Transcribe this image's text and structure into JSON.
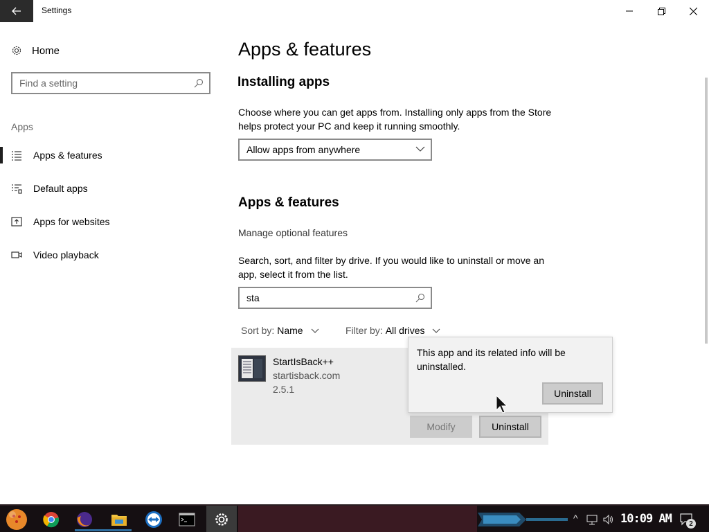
{
  "window": {
    "title": "Settings",
    "controls": [
      "minimize",
      "maximize",
      "close"
    ]
  },
  "sidebar": {
    "home_label": "Home",
    "search_placeholder": "Find a setting",
    "group_label": "Apps",
    "items": [
      {
        "label": "Apps & features",
        "icon": "apps-list-icon",
        "active": true
      },
      {
        "label": "Default apps",
        "icon": "default-apps-icon",
        "active": false
      },
      {
        "label": "Apps for websites",
        "icon": "apps-websites-icon",
        "active": false
      },
      {
        "label": "Video playback",
        "icon": "video-icon",
        "active": false
      }
    ]
  },
  "main": {
    "page_title": "Apps & features",
    "installing": {
      "heading": "Installing apps",
      "description": "Choose where you can get apps from. Installing only apps from the Store helps protect your PC and keep it running smoothly.",
      "dropdown_value": "Allow apps from anywhere"
    },
    "features": {
      "heading": "Apps & features",
      "manage_link": "Manage optional features",
      "description": "Search, sort, and filter by drive. If you would like to uninstall or move an app, select it from the list.",
      "search_value": "sta",
      "sort_label": "Sort by:",
      "sort_value": "Name",
      "filter_label": "Filter by:",
      "filter_value": "All drives"
    },
    "app": {
      "name": "StartIsBack++",
      "publisher": "startisback.com",
      "version": "2.5.1",
      "modify_label": "Modify",
      "uninstall_label": "Uninstall"
    },
    "flyout": {
      "message": "This app and its related info will be uninstalled.",
      "confirm_label": "Uninstall"
    }
  },
  "taskbar": {
    "apps": [
      "start-orb-icon",
      "chrome-icon",
      "firefox-icon",
      "file-explorer-icon",
      "teamviewer-icon",
      "command-prompt-icon",
      "settings-gear-icon"
    ],
    "clock": "10:09 AM",
    "notification_count": "2"
  },
  "colors": {
    "back_button": "#2b2b2b",
    "card_bg": "#ebebeb",
    "button_bg": "#cccccc",
    "taskbar_bg": "#150f12",
    "taskbar_maroon": "#3a1a22",
    "accent_blue": "#2e6ea0"
  }
}
